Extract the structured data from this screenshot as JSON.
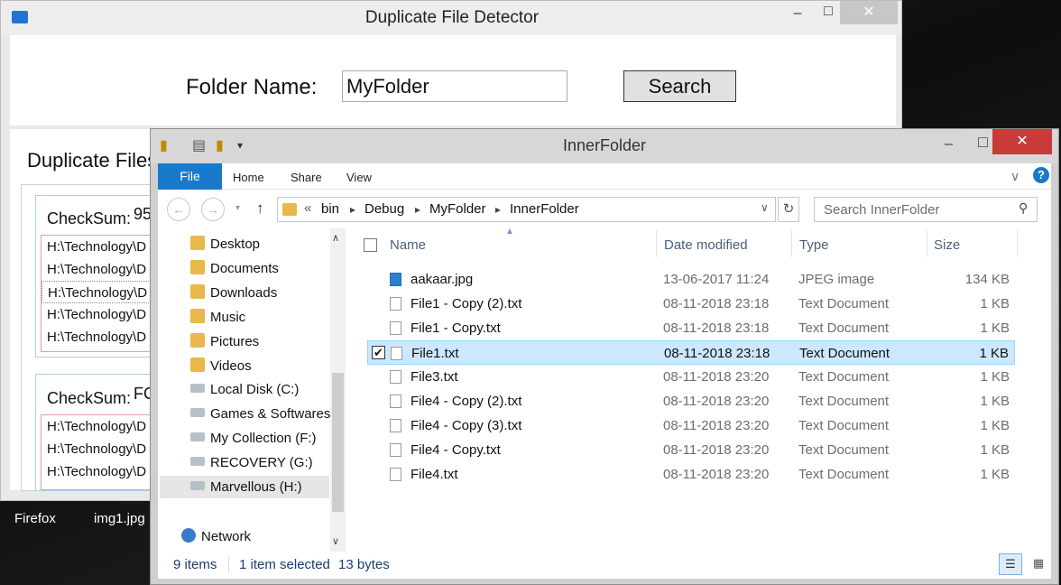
{
  "desktop": {
    "icons": [
      "Firefox",
      "img1.jpg"
    ]
  },
  "app": {
    "title": "Duplicate File Detector",
    "folder_label": "Folder Name:",
    "folder_value": "MyFolder",
    "search_label": "Search",
    "duplicates_title": "Duplicate Files",
    "groups": [
      {
        "checksum_label": "CheckSum:",
        "checksum": "95",
        "paths": [
          "H:\\Technology\\D",
          "H:\\Technology\\D",
          "H:\\Technology\\D",
          "H:\\Technology\\D",
          "H:\\Technology\\D"
        ]
      },
      {
        "checksum_label": "CheckSum:",
        "checksum": "FC",
        "paths": [
          "H:\\Technology\\D",
          "H:\\Technology\\D",
          "H:\\Technology\\D"
        ]
      }
    ],
    "window_buttons": {
      "minimize": "–",
      "maximize": "□",
      "close": "✕"
    }
  },
  "explorer": {
    "title": "InnerFolder",
    "ribbon": {
      "file": "File",
      "tabs": [
        "Home",
        "Share",
        "View"
      ]
    },
    "address": {
      "prefix": "«",
      "crumbs": [
        "bin",
        "Debug",
        "MyFolder",
        "InnerFolder"
      ]
    },
    "search_placeholder": "Search InnerFolder",
    "nav": {
      "items": [
        {
          "label": "Desktop",
          "icon": "folder-icon"
        },
        {
          "label": "Documents",
          "icon": "folder-icon"
        },
        {
          "label": "Downloads",
          "icon": "folder-icon"
        },
        {
          "label": "Music",
          "icon": "folder-icon"
        },
        {
          "label": "Pictures",
          "icon": "folder-icon"
        },
        {
          "label": "Videos",
          "icon": "folder-icon"
        },
        {
          "label": "Local Disk (C:)",
          "icon": "drive-icon"
        },
        {
          "label": "Games & Softwares",
          "icon": "drive-icon"
        },
        {
          "label": "My Collection (F:)",
          "icon": "drive-icon"
        },
        {
          "label": "RECOVERY (G:)",
          "icon": "drive-icon"
        },
        {
          "label": "Marvellous (H:)",
          "icon": "drive-icon"
        }
      ],
      "network": "Network",
      "selected": "Marvellous (H:)"
    },
    "columns": [
      "Name",
      "Date modified",
      "Type",
      "Size"
    ],
    "files": [
      {
        "name": "aakaar.jpg",
        "date": "13-06-2017 11:24",
        "type": "JPEG image",
        "size": "134 KB",
        "icon": "image-file-icon"
      },
      {
        "name": "File1 - Copy (2).txt",
        "date": "08-11-2018 23:18",
        "type": "Text Document",
        "size": "1 KB",
        "icon": "text-file-icon"
      },
      {
        "name": "File1 - Copy.txt",
        "date": "08-11-2018 23:18",
        "type": "Text Document",
        "size": "1 KB",
        "icon": "text-file-icon"
      },
      {
        "name": "File1.txt",
        "date": "08-11-2018 23:18",
        "type": "Text Document",
        "size": "1 KB",
        "icon": "text-file-icon",
        "selected": true
      },
      {
        "name": "File3.txt",
        "date": "08-11-2018 23:20",
        "type": "Text Document",
        "size": "1 KB",
        "icon": "text-file-icon"
      },
      {
        "name": "File4 - Copy (2).txt",
        "date": "08-11-2018 23:20",
        "type": "Text Document",
        "size": "1 KB",
        "icon": "text-file-icon"
      },
      {
        "name": "File4 - Copy (3).txt",
        "date": "08-11-2018 23:20",
        "type": "Text Document",
        "size": "1 KB",
        "icon": "text-file-icon"
      },
      {
        "name": "File4 - Copy.txt",
        "date": "08-11-2018 23:20",
        "type": "Text Document",
        "size": "1 KB",
        "icon": "text-file-icon"
      },
      {
        "name": "File4.txt",
        "date": "08-11-2018 23:20",
        "type": "Text Document",
        "size": "1 KB",
        "icon": "text-file-icon"
      }
    ],
    "status": {
      "items": "9 items",
      "selected": "1 item selected",
      "bytes": "13 bytes"
    },
    "colors": {
      "accent": "#1979ca",
      "selection": "#cce8ff",
      "close": "#c93a3a"
    }
  }
}
